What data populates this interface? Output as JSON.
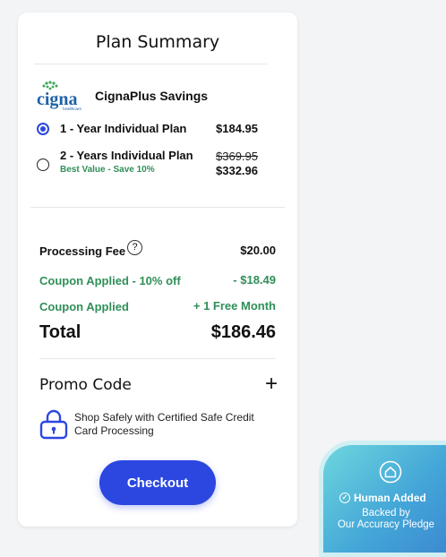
{
  "summary": {
    "title": "Plan Summary",
    "plan_name": "CignaPlus Savings",
    "logo_text": "cigna",
    "logo_subtext": "healthcare",
    "options": [
      {
        "label": "1 - Year Individual Plan",
        "price": "$184.95",
        "selected": true
      },
      {
        "label": "2 - Years Individual Plan",
        "original_price": "$369.95",
        "price": "$332.96",
        "note": "Best Value - Save 10%",
        "selected": false
      }
    ]
  },
  "fees": {
    "processing_label": "Processing Fee",
    "processing_value": "$20.00",
    "help_glyph": "?",
    "coupon1_label": "Coupon Applied - 10% off",
    "coupon1_value": "- $18.49",
    "coupon2_label": "Coupon Applied",
    "coupon2_value": "+ 1 Free Month",
    "total_label": "Total",
    "total_value": "$186.46"
  },
  "promo": {
    "label": "Promo Code",
    "toggle": "+"
  },
  "security": {
    "text": "Shop Safely with Certified Safe Credit Card Processing"
  },
  "checkout": {
    "label": "Checkout"
  },
  "badge": {
    "title": "Human Added",
    "subtitle_line1": "Backed by",
    "subtitle_line2": "Our Accuracy Pledge"
  },
  "colors": {
    "accent": "#2b47e0",
    "green": "#2f8f58",
    "badge": "#44a7d8"
  }
}
